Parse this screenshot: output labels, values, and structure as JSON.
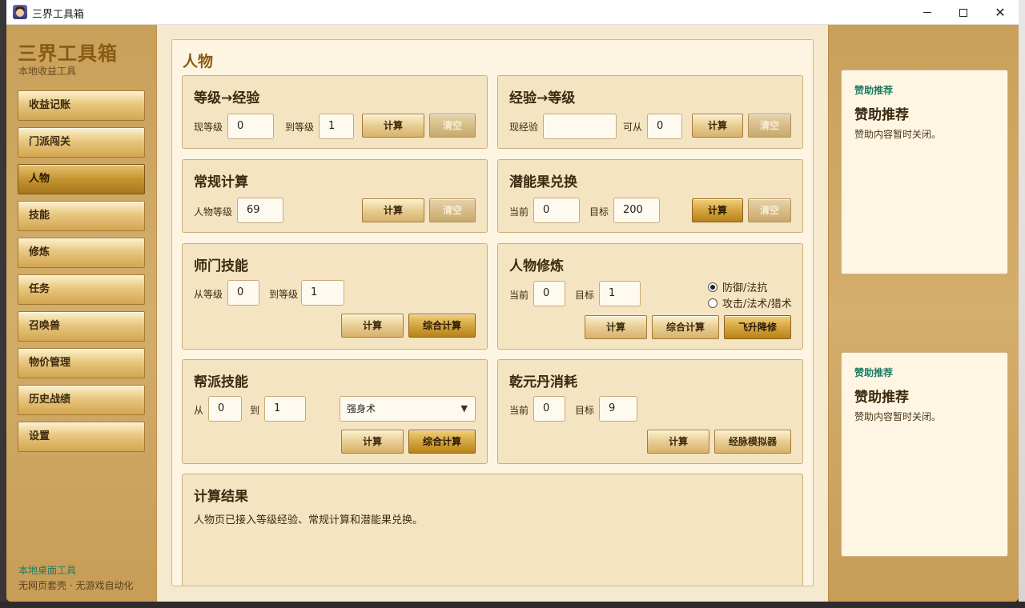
{
  "window": {
    "title": "三界工具箱"
  },
  "sidebar": {
    "brand_title": "三界工具箱",
    "brand_subtitle": "本地收益工具",
    "items": [
      {
        "label": "收益记账"
      },
      {
        "label": "门派闯关"
      },
      {
        "label": "人物",
        "active": true
      },
      {
        "label": "技能"
      },
      {
        "label": "修炼"
      },
      {
        "label": "任务"
      },
      {
        "label": "召唤兽"
      },
      {
        "label": "物价管理"
      },
      {
        "label": "历史战绩"
      },
      {
        "label": "设置"
      }
    ],
    "footer_line1": "本地桌面工具",
    "footer_line2": "无网页套壳 · 无游戏自动化"
  },
  "page": {
    "title": "人物"
  },
  "cards": {
    "level_to_exp": {
      "title": "等级→经验",
      "current_label": "现等级",
      "current_value": "0",
      "target_label": "到等级",
      "target_value": "1",
      "calc": "计算",
      "clear": "清空"
    },
    "exp_to_level": {
      "title": "经验→等级",
      "exp_label": "现经验",
      "exp_value": "",
      "from_label": "可从",
      "from_value": "0",
      "calc": "计算",
      "clear": "清空"
    },
    "regular": {
      "title": "常规计算",
      "level_label": "人物等级",
      "level_value": "69",
      "calc": "计算",
      "clear": "清空"
    },
    "potential": {
      "title": "潜能果兑换",
      "current_label": "当前",
      "current_value": "0",
      "target_label": "目标",
      "target_value": "200",
      "calc": "计算",
      "clear": "清空"
    },
    "school_skill": {
      "title": "师门技能",
      "from_label": "从等级",
      "from_value": "0",
      "to_label": "到等级",
      "to_value": "1",
      "calc": "计算",
      "combo": "综合计算"
    },
    "cultivation": {
      "title": "人物修炼",
      "current_label": "当前",
      "current_value": "0",
      "target_label": "目标",
      "target_value": "1",
      "radio_defense": "防御/法抗",
      "radio_attack": "攻击/法术/猎术",
      "calc": "计算",
      "combo": "综合计算",
      "ascend": "飞升降修"
    },
    "guild_skill": {
      "title": "帮派技能",
      "from_label": "从",
      "from_value": "0",
      "to_label": "到",
      "to_value": "1",
      "select_value": "强身术",
      "calc": "计算",
      "combo": "综合计算"
    },
    "qianyuan": {
      "title": "乾元丹消耗",
      "current_label": "当前",
      "current_value": "0",
      "target_label": "目标",
      "target_value": "9",
      "calc": "计算",
      "simulator": "经脉模拟器"
    },
    "result": {
      "title": "计算结果",
      "text": "人物页已接入等级经验、常规计算和潜能果兑换。"
    }
  },
  "sponsors": [
    {
      "tag": "赞助推荐",
      "title": "赞助推荐",
      "desc": "赞助内容暂时关闭。"
    },
    {
      "tag": "赞助推荐",
      "title": "赞助推荐",
      "desc": "赞助内容暂时关闭。"
    }
  ]
}
